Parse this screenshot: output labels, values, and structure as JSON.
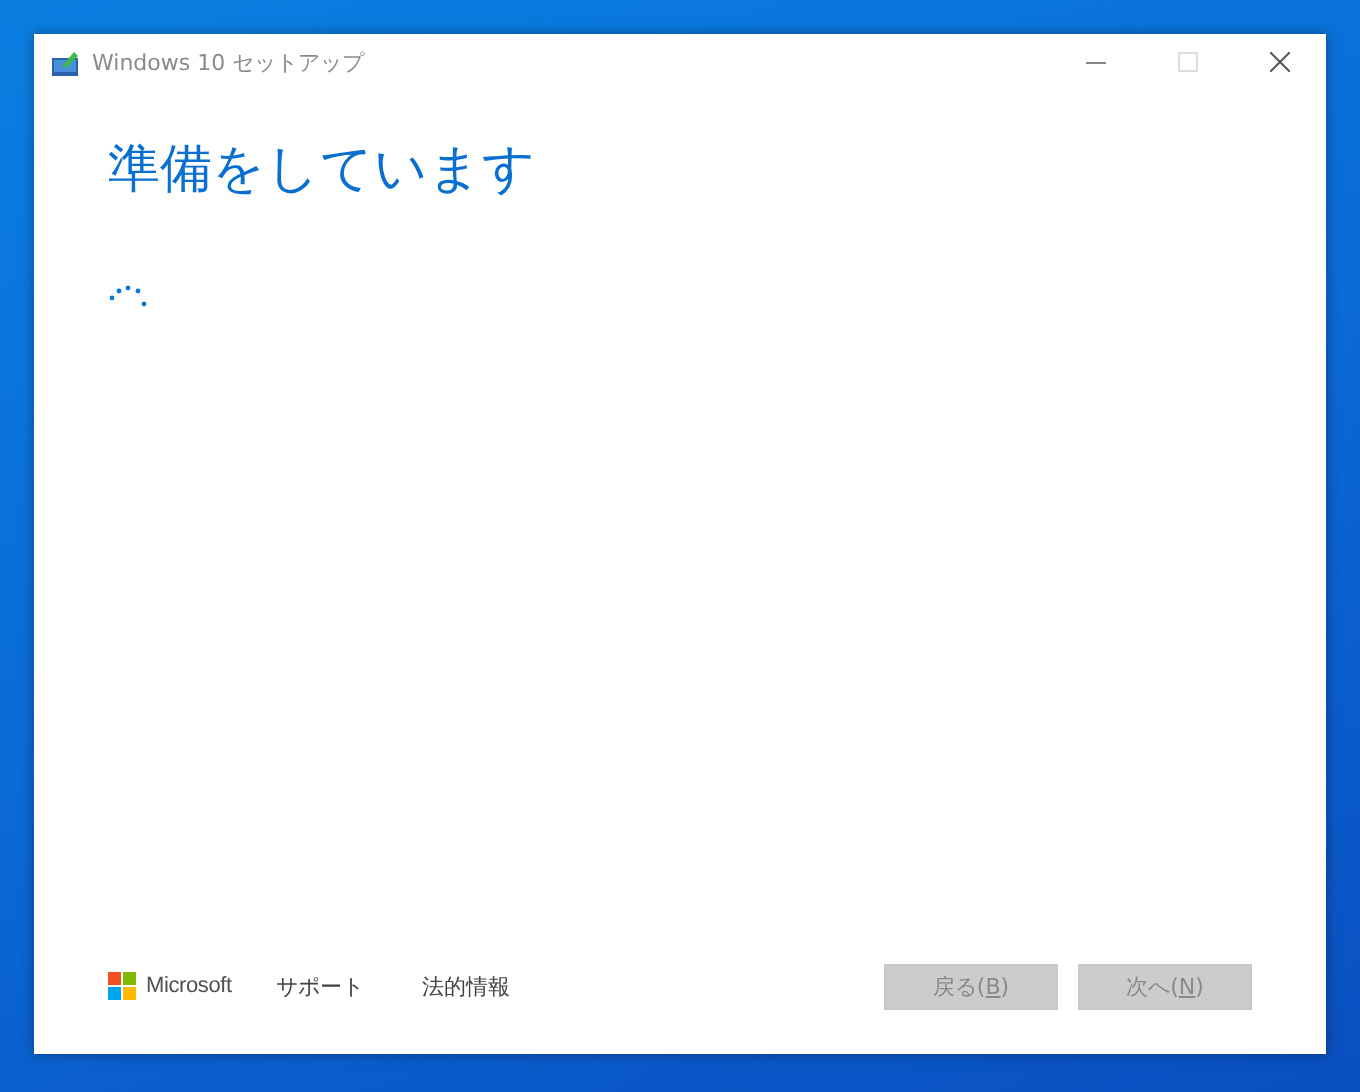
{
  "window": {
    "title": "Windows 10 セットアップ"
  },
  "heading": "準備をしています",
  "footer": {
    "brand": "Microsoft",
    "links": [
      "サポート",
      "法的情報"
    ],
    "buttons": [
      {
        "before": "戻る(",
        "access_key": "B",
        "after": ")",
        "disabled": true
      },
      {
        "before": "次へ(",
        "access_key": "N",
        "after": ")",
        "disabled": true
      }
    ]
  }
}
